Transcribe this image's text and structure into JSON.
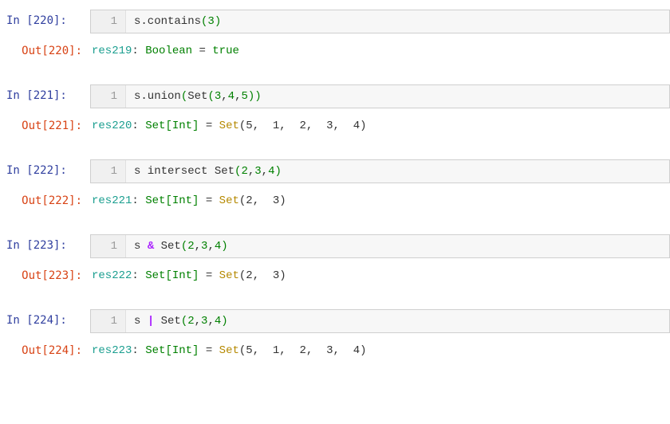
{
  "cells": {
    "c0": {
      "in_prompt": "In  [220]:",
      "line_no": "1",
      "code_prefix": "s.contains",
      "code_paren_open": "(",
      "code_arg": "3",
      "code_paren_close": ")",
      "out_prompt": "Out[220]:",
      "out_var": "res219",
      "out_colon": ": ",
      "out_type": "Boolean",
      "out_eq": " = ",
      "out_val": "true"
    },
    "c1": {
      "in_prompt": "In  [221]:",
      "line_no": "1",
      "code_prefix": "s.union",
      "code_open": "(",
      "code_set": "Set",
      "code_args_open": "(",
      "arg1": "3",
      "comma1": ",",
      "arg2": "4",
      "comma2": ",",
      "arg3": "5",
      "code_args_close": ")",
      "code_close": ")",
      "out_prompt": "Out[221]:",
      "out_var": "res220",
      "out_colon": ": ",
      "out_type": "Set[Int]",
      "out_eq": " = ",
      "out_ctor": "Set",
      "out_args": "(5,  1,  2,  3,  4)"
    },
    "c2": {
      "in_prompt": "In  [222]:",
      "line_no": "1",
      "code_s": "s intersect Set",
      "code_open": "(",
      "arg1": "2",
      "comma1": ",",
      "arg2": "3",
      "comma2": ",",
      "arg3": "4",
      "code_close": ")",
      "out_prompt": "Out[222]:",
      "out_var": "res221",
      "out_colon": ": ",
      "out_type": "Set[Int]",
      "out_eq": " = ",
      "out_ctor": "Set",
      "out_args": "(2,  3)"
    },
    "c3": {
      "in_prompt": "In  [223]:",
      "line_no": "1",
      "code_s": "s ",
      "op": "&",
      "code_rest": " Set",
      "code_open": "(",
      "arg1": "2",
      "comma1": ",",
      "arg2": "3",
      "comma2": ",",
      "arg3": "4",
      "code_close": ")",
      "out_prompt": "Out[223]:",
      "out_var": "res222",
      "out_colon": ": ",
      "out_type": "Set[Int]",
      "out_eq": " = ",
      "out_ctor": "Set",
      "out_args": "(2,  3)"
    },
    "c4": {
      "in_prompt": "In  [224]:",
      "line_no": "1",
      "code_s": "s ",
      "op": "|",
      "code_rest": " Set",
      "code_open": "(",
      "arg1": "2",
      "comma1": ",",
      "arg2": "3",
      "comma2": ",",
      "arg3": "4",
      "code_close": ")",
      "out_prompt": "Out[224]:",
      "out_var": "res223",
      "out_colon": ": ",
      "out_type": "Set[Int]",
      "out_eq": " = ",
      "out_ctor": "Set",
      "out_args": "(5,  1,  2,  3,  4)"
    }
  }
}
